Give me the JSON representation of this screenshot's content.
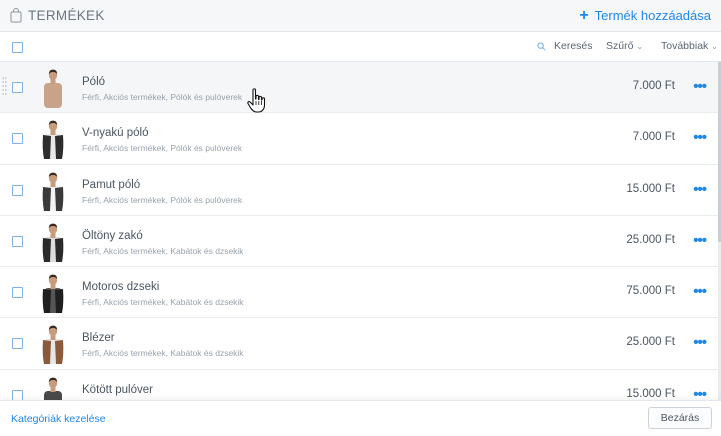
{
  "header": {
    "title": "TERMÉKEK",
    "add_button": "Termék hozzáadása"
  },
  "toolbar": {
    "search_label": "Keresés",
    "filter_label": "Szűrő",
    "more_label": "Továbbiak"
  },
  "products": [
    {
      "name": "Póló",
      "categories": "Férfi, Akciós termékek, Pólók és pulóverek",
      "price": "7.000 Ft",
      "shirt": "#c9a28a",
      "jacket": "",
      "hovered": true
    },
    {
      "name": "V-nyakú póló",
      "categories": "Férfi, Akciós termékek, Pólók és pulóverek",
      "price": "7.000 Ft",
      "shirt": "#e8e8e8",
      "jacket": "#2e2e2e",
      "hovered": false
    },
    {
      "name": "Pamut póló",
      "categories": "Férfi, Akciós termékek, Pólók és pulóverek",
      "price": "15.000 Ft",
      "shirt": "#f2f2f2",
      "jacket": "#3a3a3a",
      "hovered": false
    },
    {
      "name": "Öltöny zakó",
      "categories": "Férfi, Akciós termékek, Kabátok és dzsekik",
      "price": "25.000 Ft",
      "shirt": "#dcdcdc",
      "jacket": "#2a2a2a",
      "hovered": false
    },
    {
      "name": "Motoros dzseki",
      "categories": "Férfi, Akciós termékek, Kabátok és dzsekik",
      "price": "75.000 Ft",
      "shirt": "#555555",
      "jacket": "#1f1f1f",
      "hovered": false
    },
    {
      "name": "Blézer",
      "categories": "Férfi, Akciós termékek, Kabátok és dzsekik",
      "price": "25.000 Ft",
      "shirt": "#e6e6e6",
      "jacket": "#8a5a3a",
      "hovered": false
    },
    {
      "name": "Kötött pulóver",
      "categories": "",
      "price": "15.000 Ft",
      "shirt": "#4a4a4a",
      "jacket": "",
      "hovered": false
    }
  ],
  "footer": {
    "manage_categories": "Kategóriák kezelése",
    "close_button": "Bezárás"
  },
  "colors": {
    "accent": "#1e88e5",
    "text": "#4a5562",
    "muted": "#98a2ad"
  }
}
